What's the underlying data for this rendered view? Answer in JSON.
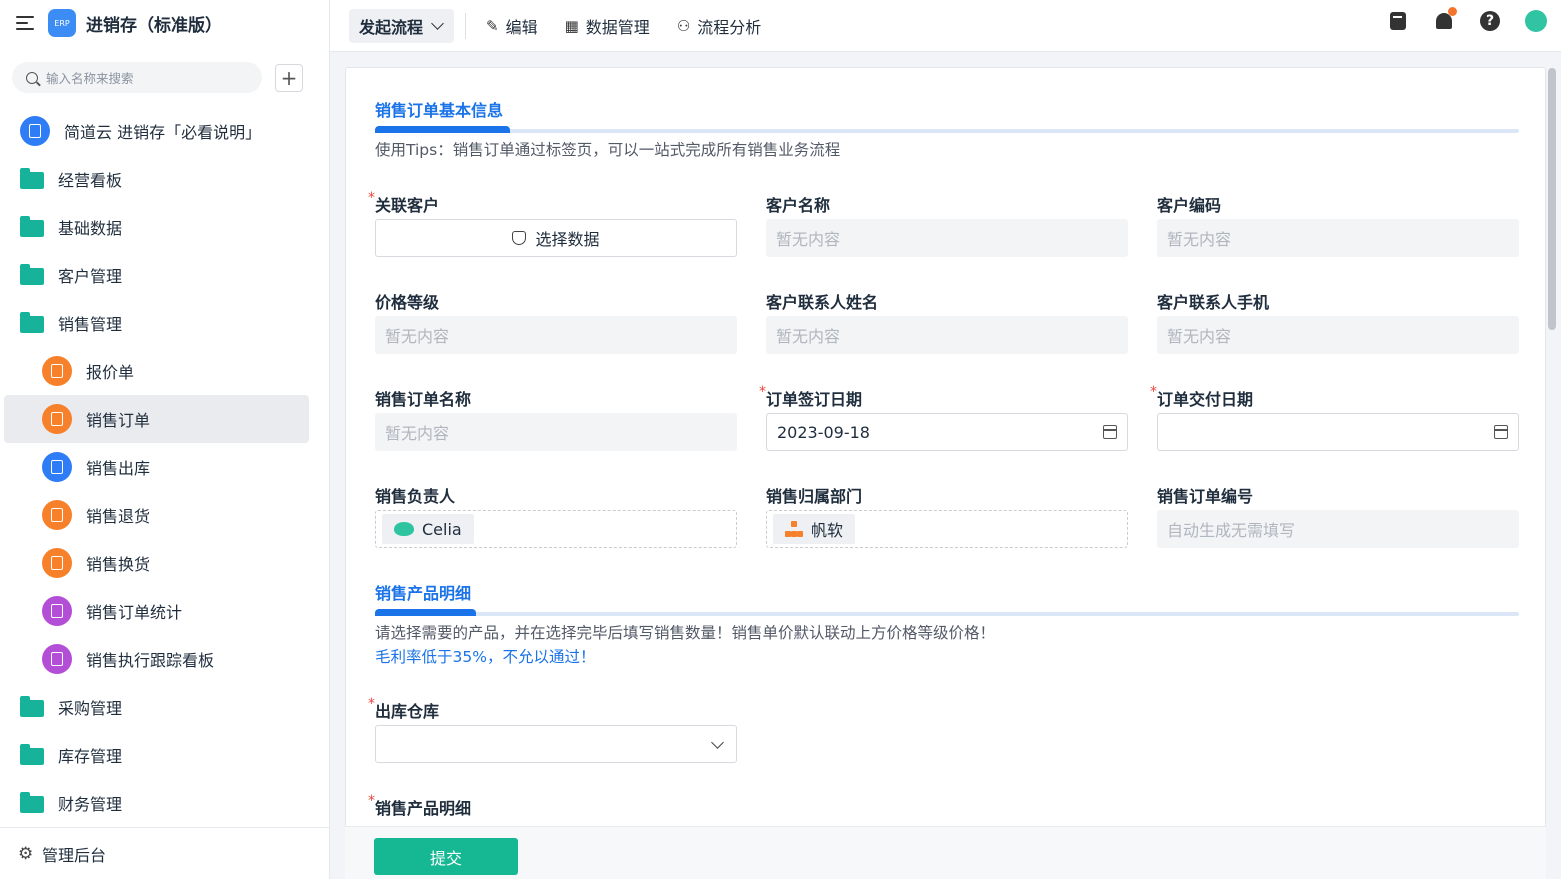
{
  "app": {
    "logo_text": "ERP",
    "title": "进销存（标准版）"
  },
  "search": {
    "placeholder": "输入名称来搜索",
    "add": "+"
  },
  "sidebar": {
    "items": [
      {
        "label": "简道云 进销存「必看说明」",
        "icon": "document-icon"
      },
      {
        "label": "经营看板",
        "icon": "folder-icon"
      },
      {
        "label": "基础数据",
        "icon": "folder-icon"
      },
      {
        "label": "客户管理",
        "icon": "folder-icon"
      },
      {
        "label": "销售管理",
        "icon": "folder-open-icon"
      },
      {
        "label": "报价单",
        "icon": "form-icon"
      },
      {
        "label": "销售订单",
        "icon": "form-icon",
        "active": true
      },
      {
        "label": "销售出库",
        "icon": "document-icon"
      },
      {
        "label": "销售退货",
        "icon": "form-icon"
      },
      {
        "label": "销售换货",
        "icon": "form-icon"
      },
      {
        "label": "销售订单统计",
        "icon": "dashboard-icon"
      },
      {
        "label": "销售执行跟踪看板",
        "icon": "dashboard-icon"
      },
      {
        "label": "采购管理",
        "icon": "folder-icon"
      },
      {
        "label": "库存管理",
        "icon": "folder-icon"
      },
      {
        "label": "财务管理",
        "icon": "folder-icon"
      }
    ],
    "admin": "管理后台"
  },
  "topbar": {
    "start_flow": "发起流程",
    "edit": "编辑",
    "data_manage": "数据管理",
    "flow_analysis": "流程分析"
  },
  "form": {
    "section1": {
      "title": "销售订单基本信息",
      "tip": "使用Tips：销售订单通过标签页，可以一站式完成所有销售业务流程"
    },
    "fields": {
      "customer": {
        "label": "关联客户",
        "button": "选择数据"
      },
      "customer_name": {
        "label": "客户名称",
        "value": "暂无内容"
      },
      "customer_code": {
        "label": "客户编码",
        "value": "暂无内容"
      },
      "price_level": {
        "label": "价格等级",
        "value": "暂无内容"
      },
      "contact_name": {
        "label": "客户联系人姓名",
        "value": "暂无内容"
      },
      "contact_phone": {
        "label": "客户联系人手机",
        "value": "暂无内容"
      },
      "order_name": {
        "label": "销售订单名称",
        "value": "暂无内容"
      },
      "sign_date": {
        "label": "订单签订日期",
        "value": "2023-09-18"
      },
      "delivery_date": {
        "label": "订单交付日期",
        "value": ""
      },
      "owner": {
        "label": "销售负责人",
        "value": "Celia"
      },
      "department": {
        "label": "销售归属部门",
        "value": "帆软"
      },
      "order_no": {
        "label": "销售订单编号",
        "value": "自动生成无需填写"
      }
    },
    "section2": {
      "title": "销售产品明细",
      "tip": "请选择需要的产品，并在选择完毕后填写销售数量！销售单价默认联动上方价格等级价格！",
      "tip2": "毛利率低于35%，不允以通过！"
    },
    "warehouse": {
      "label": "出库仓库",
      "value": ""
    },
    "product_detail": {
      "label": "销售产品明细"
    },
    "submit": "提交"
  }
}
